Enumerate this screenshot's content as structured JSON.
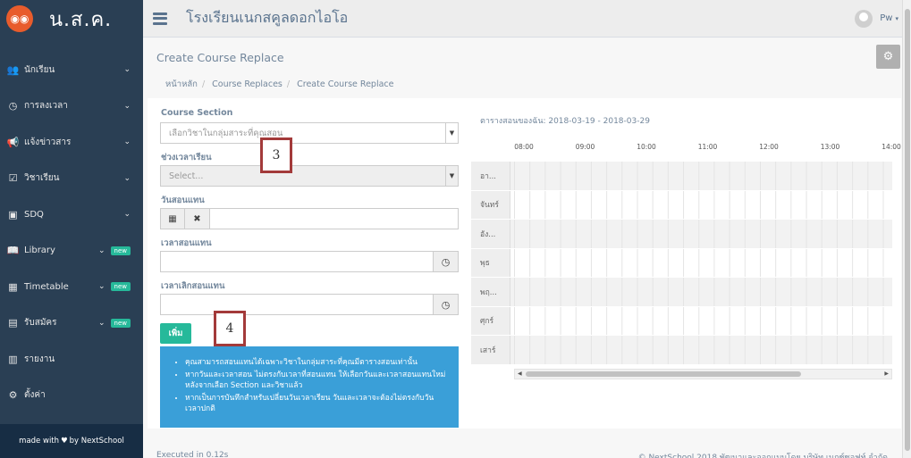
{
  "brand": {
    "title": "น.ส.ค.",
    "logo_icon": "owl-logo-icon"
  },
  "sidebar": {
    "items": [
      {
        "label": "นักเรียน",
        "icon": "users-icon",
        "glyph": "👥",
        "badge": ""
      },
      {
        "label": "การลงเวลา",
        "icon": "clock-icon",
        "glyph": "◷",
        "badge": ""
      },
      {
        "label": "แจ้งข่าวสาร",
        "icon": "bullhorn-icon",
        "glyph": "📢",
        "badge": ""
      },
      {
        "label": "วิชาเรียน",
        "icon": "calendar-check-icon",
        "glyph": "☑",
        "badge": ""
      },
      {
        "label": "SDQ",
        "icon": "list-icon",
        "glyph": "▣",
        "badge": ""
      },
      {
        "label": "Library",
        "icon": "book-icon",
        "glyph": "📖",
        "badge": "new"
      },
      {
        "label": "Timetable",
        "icon": "table-icon",
        "glyph": "▦",
        "badge": "new"
      },
      {
        "label": "รับสมัคร",
        "icon": "register-icon",
        "glyph": "▤",
        "badge": "new"
      },
      {
        "label": "รายงาน",
        "icon": "bar-chart-icon",
        "glyph": "▥",
        "badge": ""
      },
      {
        "label": "ตั้งค่า",
        "icon": "cogs-icon",
        "glyph": "⚙",
        "badge": ""
      }
    ],
    "footer_prefix": "made with",
    "footer_suffix": "by NextSchool"
  },
  "topbar": {
    "school_name": "โรงเรียนเนกสคูลดอกไอโอ",
    "user_name": "Pw"
  },
  "page": {
    "title": "Create Course Replace",
    "breadcrumb": [
      "หน้าหลัก",
      "Course Replaces",
      "Create Course Replace"
    ]
  },
  "form": {
    "course_section_label": "Course Section",
    "course_section_placeholder": "เลือกวิชาในกลุ่มสาระที่คุณสอน",
    "period_label": "ช่วงเวลาเรียน",
    "period_placeholder": "Select...",
    "date_label": "วันสอนแทน",
    "start_time_label": "เวลาสอนแทน",
    "end_time_label": "เวลาเลิกสอนแทน",
    "add_button": "เพิ่ม",
    "info_items": [
      "คุณสามารถสอนแทนได้เฉพาะวิชาในกลุ่มสาระที่คุณมีตารางสอนเท่านั้น",
      "หากวันและเวลาสอน ไม่ตรงกับเวลาที่สอนแทน ให้เลือกวันและเวลาสอนแทนใหม่หลังจากเลือก Section และวิชาแล้ว",
      "หากเป็นการบันทึกสำหรับเปลี่ยนวันเวลาเรียน วันและเวลาจะต้องไม่ตรงกับวันเวลาปกติ"
    ],
    "info_color": "#3a9fd8"
  },
  "annotations": {
    "step3": "3",
    "step4": "4"
  },
  "timetable": {
    "title": "ตารางสอนของฉัน: 2018-03-19 - 2018-03-29",
    "hours": [
      "08:00",
      "09:00",
      "10:00",
      "11:00",
      "12:00",
      "13:00",
      "14:00"
    ],
    "days": [
      "อา...",
      "จันทร์",
      "อัง...",
      "พุธ",
      "พฤ...",
      "ศุกร์",
      "เสาร์"
    ]
  },
  "footer": {
    "executed": "Executed in 0.12s",
    "copyright": "© NextSchool 2018 พัฒนาและออกแบบโดย บริษัท เนกซ์ซอฟท์ จำกัด"
  },
  "colors": {
    "sidebar": "#2a3f54",
    "accent": "#26b99a",
    "info": "#3a9fd8"
  }
}
